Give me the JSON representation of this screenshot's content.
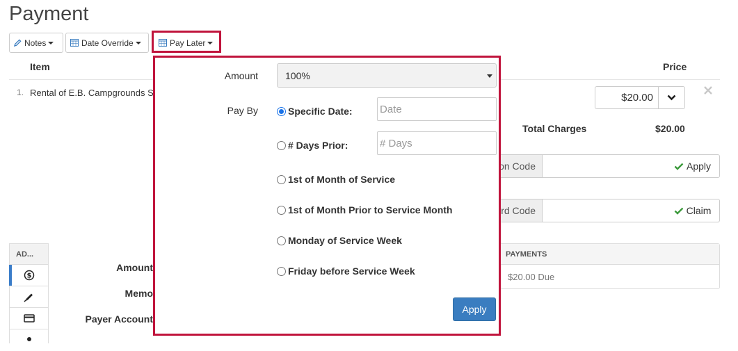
{
  "page": {
    "title": "Payment"
  },
  "toolbar": {
    "notes_label": "Notes",
    "date_override_label": "Date Override",
    "pay_later_label": "Pay Later"
  },
  "table": {
    "headers": {
      "item": "Item",
      "price": "Price"
    },
    "rows": [
      {
        "number": "1.",
        "item": "Rental of E.B. Campgrounds S",
        "price": "$20.00"
      }
    ],
    "total_label": "Total Charges",
    "total_value": "$20.00"
  },
  "coupon": {
    "label": "on Code",
    "button_label": "Apply"
  },
  "gift_card": {
    "label": "rd Code",
    "button_label": "Claim"
  },
  "payments": {
    "header": "PAYMENTS",
    "due": "$20.00 Due"
  },
  "side_tabs": {
    "header": "AD..."
  },
  "form_labels": {
    "amount": "Amount",
    "memo": "Memo",
    "payer_account": "Payer Account"
  },
  "pay_later_popup": {
    "amount_label": "Amount",
    "amount_value": "100%",
    "pay_by_label": "Pay By",
    "options": [
      {
        "label": "Specific Date:",
        "selected": true
      },
      {
        "label": "# Days Prior:",
        "selected": false
      },
      {
        "label": "1st of Month of Service",
        "selected": false
      },
      {
        "label": "1st of Month Prior to Service Month",
        "selected": false
      },
      {
        "label": "Monday of Service Week",
        "selected": false
      },
      {
        "label": "Friday before Service Week",
        "selected": false
      }
    ],
    "date_placeholder": "Date",
    "days_placeholder": "# Days",
    "apply_label": "Apply"
  },
  "colors": {
    "highlight": "#c0143c",
    "primary": "#3a7dc0",
    "success": "#3c9a3c"
  }
}
